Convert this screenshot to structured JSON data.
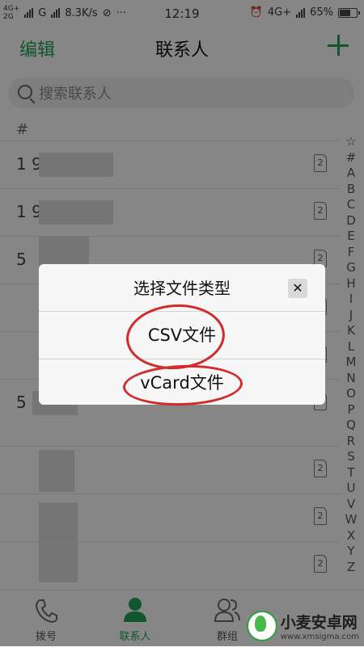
{
  "status_bar": {
    "network_top": "4G+",
    "network_bottom": "2G",
    "carrier": "G",
    "speed": "8.3K/s",
    "time": "12:19",
    "right_network": "4G+",
    "battery": "65%"
  },
  "header": {
    "edit_label": "编辑",
    "title": "联系人",
    "add_icon": "plus-icon"
  },
  "search": {
    "placeholder": "搜索联系人"
  },
  "list": {
    "section": "#",
    "rows": [
      {
        "name": "1 9",
        "sim": "2"
      },
      {
        "name": "1 9",
        "sim": "2"
      },
      {
        "name": "5",
        "sim": "2"
      },
      {
        "name": "",
        "sim": "2"
      },
      {
        "name": "",
        "sim": "2"
      },
      {
        "name": "5",
        "sim": "2"
      },
      {
        "name": "",
        "sim": "2"
      },
      {
        "name": "",
        "sim": "2"
      },
      {
        "name": "",
        "sim": "2"
      }
    ]
  },
  "index_letters": [
    "☆",
    "#",
    "A",
    "B",
    "C",
    "D",
    "E",
    "F",
    "G",
    "H",
    "I",
    "J",
    "K",
    "L",
    "M",
    "N",
    "O",
    "P",
    "Q",
    "R",
    "S",
    "T",
    "U",
    "V",
    "W",
    "X",
    "Y",
    "Z"
  ],
  "bottom_nav": {
    "tabs": [
      {
        "label": "拨号",
        "icon": "phone-icon"
      },
      {
        "label": "联系人",
        "icon": "person-icon"
      },
      {
        "label": "群组",
        "icon": "group-icon"
      }
    ]
  },
  "dialog": {
    "title": "选择文件类型",
    "close_icon": "close-icon",
    "close_glyph": "✕",
    "options": [
      "CSV文件",
      "vCard文件"
    ],
    "annotation_color": "#d42a2a"
  },
  "watermark": {
    "name": "小麦安卓网",
    "url": "www.xmsigma.com"
  },
  "colors": {
    "accent": "#1f9d55"
  }
}
